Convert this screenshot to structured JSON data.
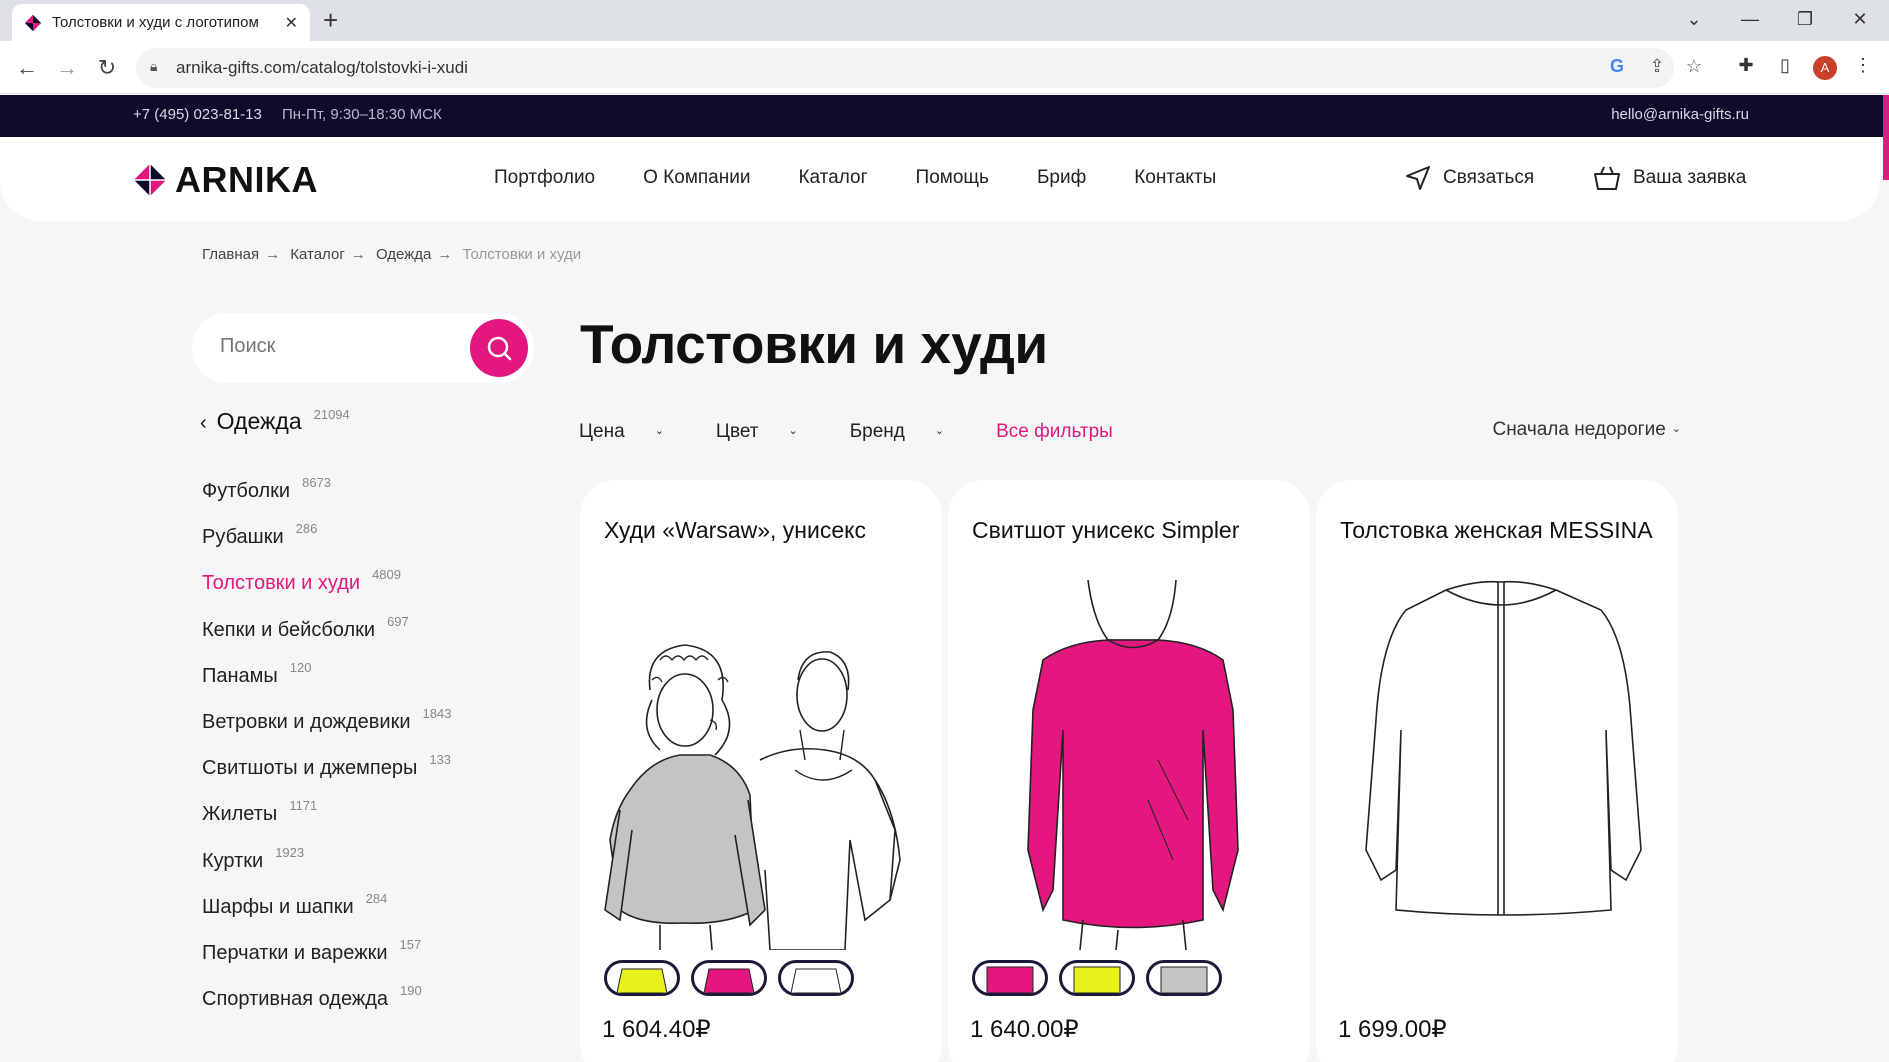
{
  "browser": {
    "tab_title": "Толстовки и худи с логотипом",
    "url": "arnika-gifts.com/catalog/tolstovki-i-xudi",
    "profile_initial": "A",
    "icons": [
      "back-icon",
      "forward-icon",
      "reload-icon",
      "lock-icon",
      "google-icon",
      "share-icon",
      "star-icon",
      "extensions-icon",
      "side-panel-icon",
      "menu-icon"
    ]
  },
  "topbar": {
    "phone": "+7 (495) 023-81-13",
    "hours": "Пн-Пт, 9:30–18:30 МСК",
    "email": "hello@arnika-gifts.ru"
  },
  "header": {
    "logo_text": "ARNIKA",
    "menu": [
      "Портфолио",
      "О Компании",
      "Каталог",
      "Помощь",
      "Бриф",
      "Контакты"
    ],
    "contact_label": "Связаться",
    "cart_label": "Ваша заявка"
  },
  "breadcrumb": [
    "Главная",
    "Каталог",
    "Одежда",
    "Толстовки и худи"
  ],
  "sidebar": {
    "search_placeholder": "Поиск",
    "parent": {
      "label": "Одежда",
      "count": "21094"
    },
    "items": [
      {
        "label": "Футболки",
        "count": "8673"
      },
      {
        "label": "Рубашки",
        "count": "286"
      },
      {
        "label": "Толстовки и худи",
        "count": "4809"
      },
      {
        "label": "Кепки и бейсболки",
        "count": "697"
      },
      {
        "label": "Панамы",
        "count": "120"
      },
      {
        "label": "Ветровки и дождевики",
        "count": "1843"
      },
      {
        "label": "Свитшоты и джемперы",
        "count": "133"
      },
      {
        "label": "Жилеты",
        "count": "1171"
      },
      {
        "label": "Куртки",
        "count": "1923"
      },
      {
        "label": "Шарфы и шапки",
        "count": "284"
      },
      {
        "label": "Перчатки и варежки",
        "count": "157"
      },
      {
        "label": "Спортивная одежда",
        "count": "190"
      }
    ]
  },
  "main": {
    "title": "Толстовки и худи",
    "filters": [
      "Цена",
      "Цвет",
      "Бренд"
    ],
    "all_filters": "Все фильтры",
    "sort": "Сначала недорогие"
  },
  "products": [
    {
      "title": "Худи «Warsaw», унисекс",
      "price": "1 604.40₽",
      "swatches": [
        "#e6f21a",
        "#e3177e",
        "#ffffff"
      ]
    },
    {
      "title": "Свитшот унисекс Simpler",
      "price": "1 640.00₽",
      "swatches": [
        "#e3177e",
        "#e6f21a",
        "#c4c4c4"
      ]
    },
    {
      "title": "Толстовка женская MESSINA",
      "price": "1 699.00₽",
      "swatches": []
    }
  ],
  "colors": {
    "accent": "#e3177e",
    "dark": "#0f0b2b"
  }
}
